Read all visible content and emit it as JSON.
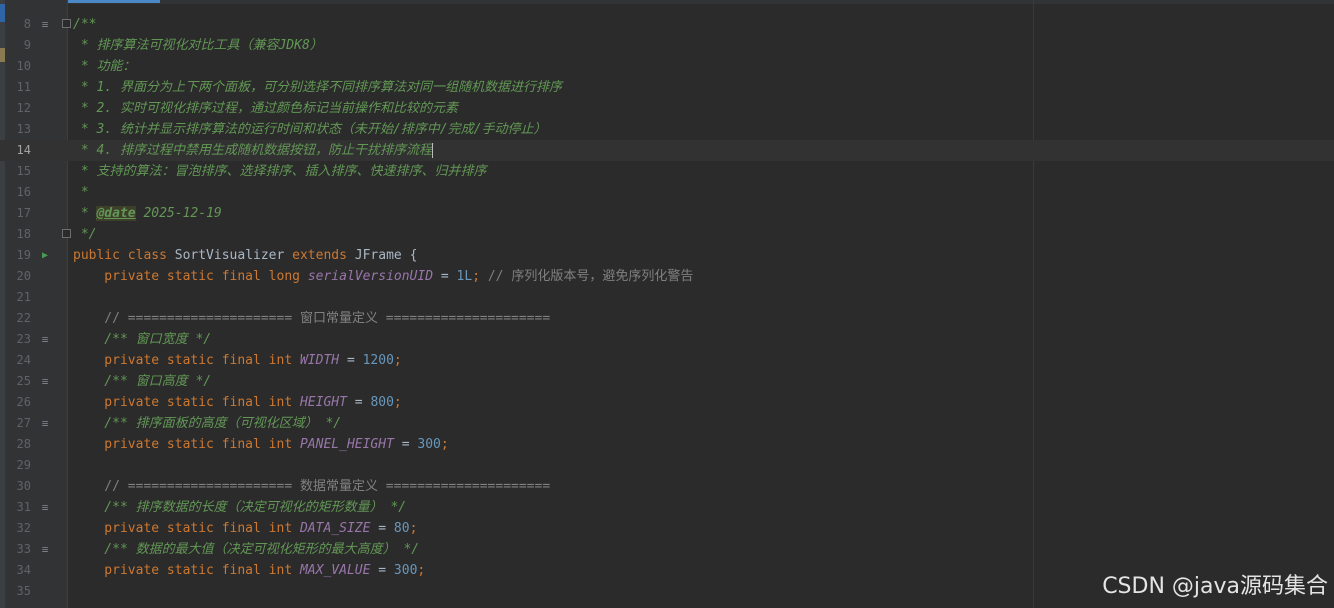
{
  "lines": {
    "l8": {
      "num": "8",
      "p1": "/**"
    },
    "l9": {
      "num": "9",
      "p1": " * 排序算法可视化对比工具（兼容JDK8）"
    },
    "l10": {
      "num": "10",
      "p1": " * 功能："
    },
    "l11": {
      "num": "11",
      "p1": " * 1. 界面分为上下两个面板，可分别选择不同排序算法对同一组随机数据进行排序"
    },
    "l12": {
      "num": "12",
      "p1": " * 2. 实时可视化排序过程，通过颜色标记当前操作和比较的元素"
    },
    "l13": {
      "num": "13",
      "p1": " * 3. 统计并显示排序算法的运行时间和状态（未开始/排序中/完成/手动停止）"
    },
    "l14": {
      "num": "14",
      "p1": " * 4. 排序过程中禁用生成随机数据按钮，防止干扰排序流程"
    },
    "l15": {
      "num": "15",
      "p1": " * 支持的算法：冒泡排序、选择排序、插入排序、快速排序、归并排序"
    },
    "l16": {
      "num": "16",
      "p1": " *"
    },
    "l17": {
      "num": "17",
      "p1": " * ",
      "p2": "@date",
      "p3": " 2025-12-19"
    },
    "l18": {
      "num": "18",
      "p1": " */"
    },
    "l19": {
      "num": "19",
      "p1": "public class ",
      "p2": "SortVisualizer ",
      "p3": "extends ",
      "p4": "JFrame {"
    },
    "l20": {
      "num": "20",
      "p1": "    private static final long ",
      "p2": "serialVersionUID",
      "p3": " = ",
      "p4": "1L",
      "p5": "; ",
      "p6": "// 序列化版本号，避免序列化警告"
    },
    "l21": {
      "num": "21"
    },
    "l22": {
      "num": "22",
      "p1": "    // ===================== 窗口常量定义 ====================="
    },
    "l23": {
      "num": "23",
      "p1": "    /** 窗口宽度 */"
    },
    "l24": {
      "num": "24",
      "p1": "    private static final int ",
      "p2": "WIDTH",
      "p3": " = ",
      "p4": "1200",
      "p5": ";"
    },
    "l25": {
      "num": "25",
      "p1": "    /** 窗口高度 */"
    },
    "l26": {
      "num": "26",
      "p1": "    private static final int ",
      "p2": "HEIGHT",
      "p3": " = ",
      "p4": "800",
      "p5": ";"
    },
    "l27": {
      "num": "27",
      "p1": "    /** 排序面板的高度（可视化区域） */"
    },
    "l28": {
      "num": "28",
      "p1": "    private static final int ",
      "p2": "PANEL_HEIGHT",
      "p3": " = ",
      "p4": "300",
      "p5": ";"
    },
    "l29": {
      "num": "29"
    },
    "l30": {
      "num": "30",
      "p1": "    // ===================== 数据常量定义 ====================="
    },
    "l31": {
      "num": "31",
      "p1": "    /** 排序数据的长度（决定可视化的矩形数量） */"
    },
    "l32": {
      "num": "32",
      "p1": "    private static final int ",
      "p2": "DATA_SIZE",
      "p3": " = ",
      "p4": "80",
      "p5": ";"
    },
    "l33": {
      "num": "33",
      "p1": "    /** 数据的最大值（决定可视化矩形的最大高度） */"
    },
    "l34": {
      "num": "34",
      "p1": "    private static final int ",
      "p2": "MAX_VALUE",
      "p3": " = ",
      "p4": "300",
      "p5": ";"
    },
    "l35": {
      "num": "35"
    }
  },
  "watermark": "CSDN @java源码集合",
  "colors": {
    "background": "#2b2b2b",
    "gutter": "#313335",
    "keyword": "#cc7832",
    "number": "#6897bb",
    "doc_comment": "#629755",
    "field": "#9876aa",
    "comment": "#808080",
    "text": "#a9b7c6"
  },
  "icons": {
    "doc_marker": "doc-comment-icon",
    "run_marker": "run-gutter-icon",
    "fold": "fold-icon"
  }
}
